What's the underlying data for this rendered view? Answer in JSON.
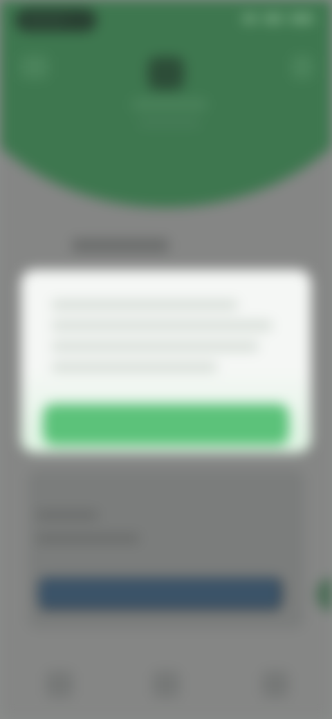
{
  "colors": {
    "header_green": "#2e7a44",
    "dialog_background": "#f5f7f5",
    "primary_button_green": "#5cc27a",
    "secondary_button_blue": "#2a4a66",
    "scrim_gray": "#8a8d8b"
  },
  "status_bar": {
    "icons": [
      "signal-icon",
      "wifi-icon",
      "battery-icon"
    ]
  },
  "header": {
    "back_icon": "back-icon",
    "menu_icon": "more-icon",
    "profile_name": "",
    "profile_subtitle": ""
  },
  "content": {
    "section_label": "",
    "button_label": ""
  },
  "dialog": {
    "message": "",
    "ok_label": ""
  },
  "bottom_nav": {
    "items": [
      "back-nav-icon",
      "home-nav-icon",
      "recents-nav-icon"
    ]
  }
}
